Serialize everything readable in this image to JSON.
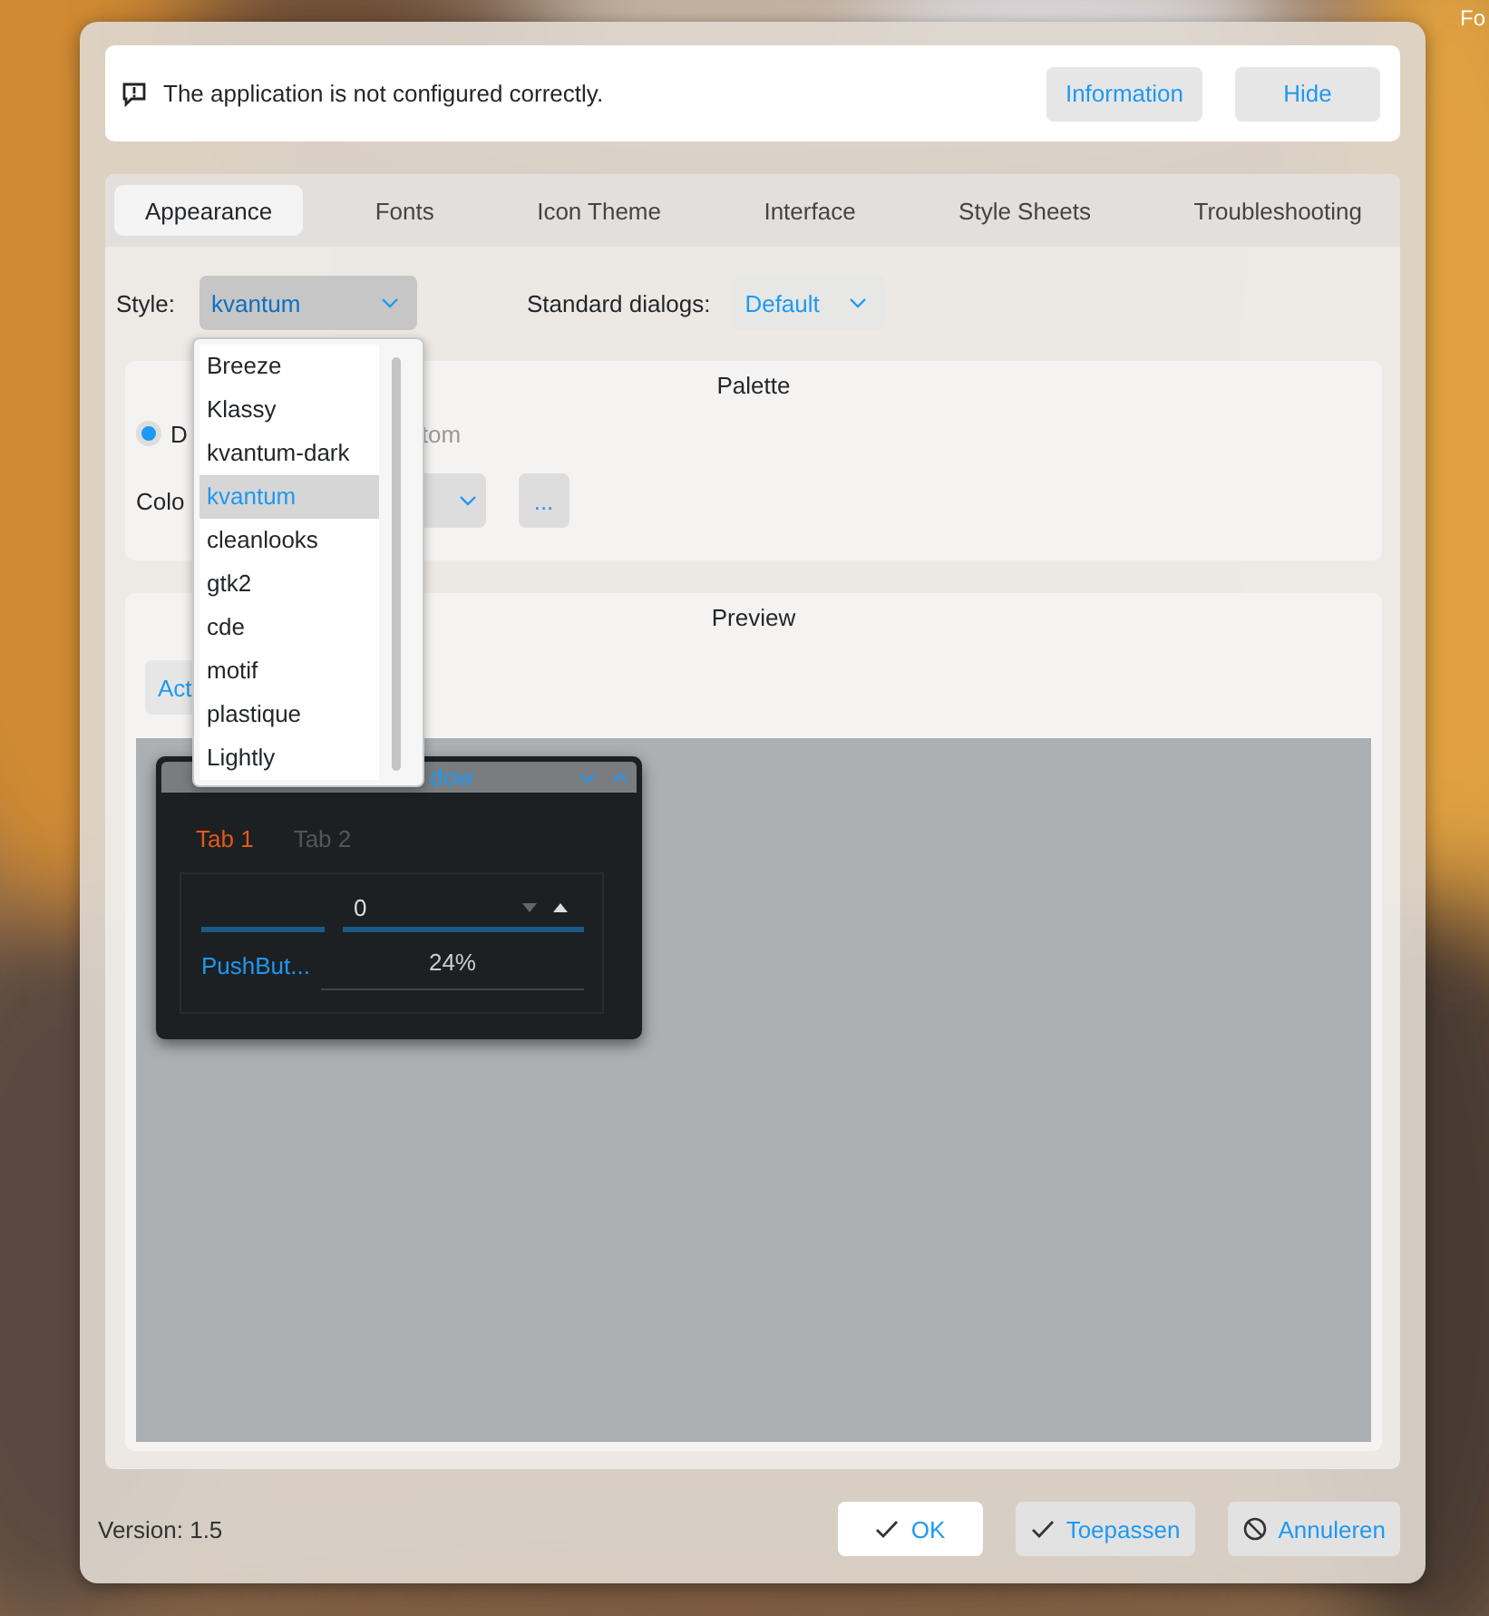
{
  "corner_text": "Fo",
  "banner": {
    "message": "The application is not configured correctly.",
    "buttons": [
      "Information",
      "Hide"
    ]
  },
  "tabs": [
    {
      "label": "Appearance",
      "selected": true
    },
    {
      "label": "Fonts",
      "selected": false
    },
    {
      "label": "Icon Theme",
      "selected": false
    },
    {
      "label": "Interface",
      "selected": false
    },
    {
      "label": "Style Sheets",
      "selected": false
    },
    {
      "label": "Troubleshooting",
      "selected": false
    }
  ],
  "style": {
    "label": "Style:",
    "value": "kvantum"
  },
  "standard_dialogs": {
    "label": "Standard dialogs:",
    "value": "Default"
  },
  "style_menu": {
    "items": [
      {
        "label": "Breeze",
        "selected": false
      },
      {
        "label": "Klassy",
        "selected": false
      },
      {
        "label": "kvantum-dark",
        "selected": false
      },
      {
        "label": "kvantum",
        "selected": true
      },
      {
        "label": "cleanlooks",
        "selected": false
      },
      {
        "label": "gtk2",
        "selected": false
      },
      {
        "label": "cde",
        "selected": false
      },
      {
        "label": "motif",
        "selected": false
      },
      {
        "label": "plastique",
        "selected": false
      },
      {
        "label": "Lightly",
        "selected": false
      }
    ]
  },
  "palette": {
    "title": "Palette",
    "radio_label": "D",
    "radio_selected": true,
    "second_radio_fragment": "tom",
    "color_label": "Colo",
    "more_button": "..."
  },
  "preview": {
    "title": "Preview",
    "button_fragment": "Act",
    "window": {
      "title_fragment": "dow",
      "tabs": [
        {
          "label": "Tab 1",
          "selected": true
        },
        {
          "label": "Tab 2",
          "selected": false
        }
      ],
      "spin_value": "0",
      "button": "PushBut...",
      "progress_text": "24%"
    }
  },
  "footer": {
    "version": "Version: 1.5",
    "buttons": [
      {
        "label": "OK",
        "kind": "check",
        "default": true
      },
      {
        "label": "Toepassen",
        "kind": "check",
        "default": false
      },
      {
        "label": "Annuleren",
        "kind": "cancel",
        "default": false
      }
    ]
  }
}
